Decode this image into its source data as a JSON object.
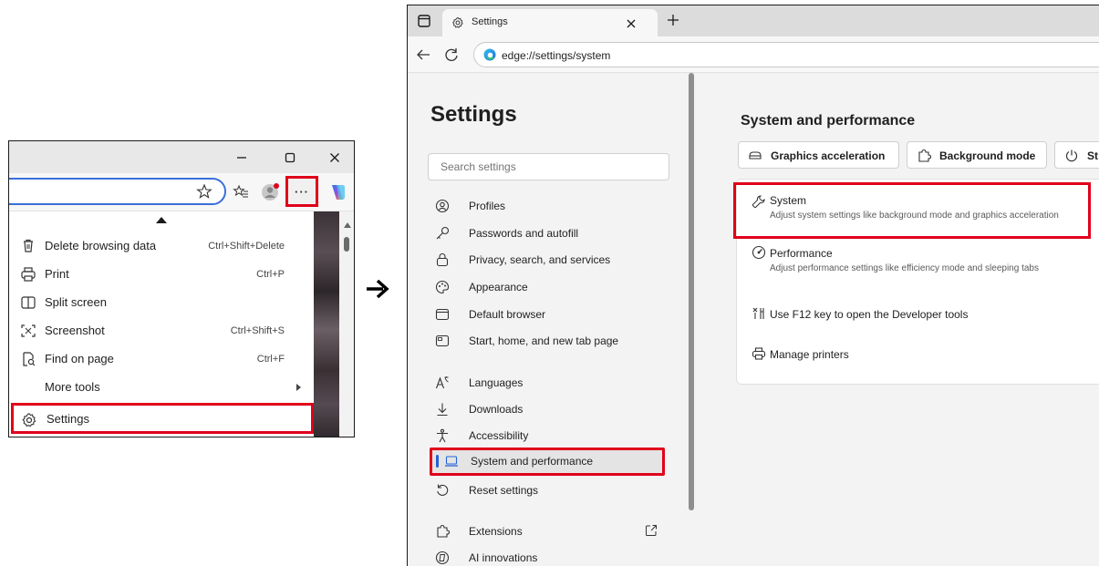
{
  "left_panel": {
    "menu": [
      {
        "label": "Delete browsing data",
        "shortcut": "Ctrl+Shift+Delete"
      },
      {
        "label": "Print",
        "shortcut": "Ctrl+P"
      },
      {
        "label": "Split screen",
        "shortcut": ""
      },
      {
        "label": "Screenshot",
        "shortcut": "Ctrl+Shift+S"
      },
      {
        "label": "Find on page",
        "shortcut": "Ctrl+F"
      },
      {
        "label": "More tools",
        "shortcut": ""
      },
      {
        "label": "Settings",
        "shortcut": ""
      }
    ],
    "more_button_label": "···"
  },
  "right_panel": {
    "tab_title": "Settings",
    "url": "edge://settings/system",
    "sidebar": {
      "title": "Settings",
      "search_placeholder": "Search settings",
      "items": [
        "Profiles",
        "Passwords and autofill",
        "Privacy, search, and services",
        "Appearance",
        "Default browser",
        "Start, home, and new tab page",
        "Languages",
        "Downloads",
        "Accessibility",
        "System and performance",
        "Reset settings",
        "Extensions",
        "AI innovations"
      ]
    },
    "main": {
      "title": "System and performance",
      "chips": [
        "Graphics acceleration",
        "Background mode",
        "St"
      ],
      "rows": [
        {
          "title": "System",
          "desc": "Adjust system settings like background mode and graphics acceleration"
        },
        {
          "title": "Performance",
          "desc": "Adjust performance settings like efficiency mode and sleeping tabs"
        },
        {
          "title": "Use F12 key to open the Developer tools",
          "desc": ""
        },
        {
          "title": "Manage printers",
          "desc": ""
        }
      ]
    }
  },
  "colors": {
    "highlight": "#e0001b",
    "accent": "#2563d6"
  }
}
